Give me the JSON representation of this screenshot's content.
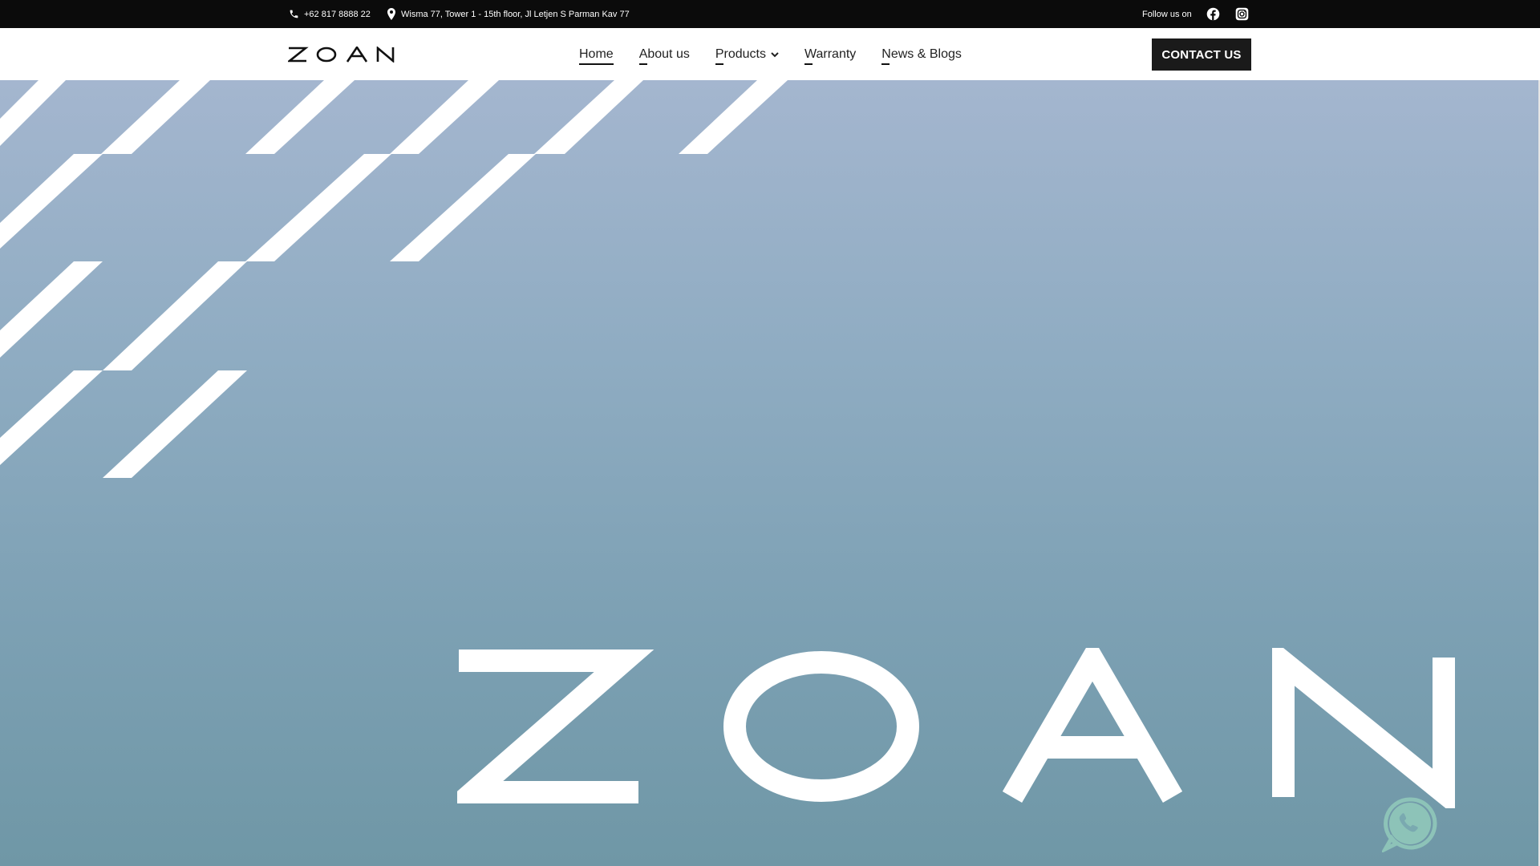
{
  "topbar": {
    "phone": "+62 817 8888 22",
    "address": "Wisma 77, Tower 1 - 15th floor, Jl Letjen S Parman Kav 77",
    "follow_label": "Follow us on",
    "icons": [
      "phone-icon",
      "location-pin-icon",
      "facebook-icon",
      "instagram-icon"
    ]
  },
  "nav": {
    "logo_text": "ZOAN",
    "items": [
      {
        "label": "Home",
        "active": true
      },
      {
        "label": "About us"
      },
      {
        "label": "Products",
        "has_dropdown": true
      },
      {
        "label": "Warranty"
      },
      {
        "label": "News & Blogs"
      }
    ],
    "contact_label": "CONTACT US"
  },
  "hero": {
    "logo_text": "ZOAN"
  },
  "floating": {
    "whatsapp_icon": "whatsapp-icon"
  },
  "colors": {
    "topbar_bg": "#0b0b0b",
    "button_bg": "#1a1a1a",
    "hero_top": "#a4b6cf",
    "hero_bottom": "#6f97a6"
  }
}
